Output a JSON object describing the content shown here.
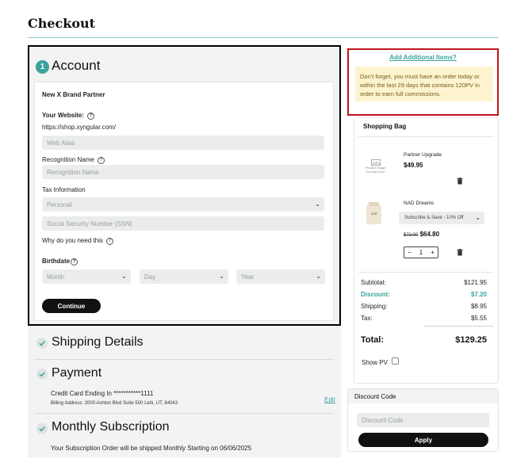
{
  "page": {
    "title": "Checkout"
  },
  "account": {
    "step_number": "1",
    "title": "Account",
    "brand_partner_label": "New X Brand Partner",
    "website_label": "Your Website:",
    "website_url": "https://shop.xyngular.com/",
    "web_alias_placeholder": "Web Alias",
    "recognition_label": "Recognition Name",
    "recognition_placeholder": "Recognition Name",
    "tax_label": "Tax Information",
    "tax_select_value": "Personal",
    "ssn_placeholder": "Social Security Number (SSN)",
    "why_label": "Why do you need this",
    "birthdate_label": "Birthdate",
    "month_value": "Month",
    "day_value": "Day",
    "year_value": "Year",
    "continue_label": "Continue"
  },
  "shipping": {
    "title": "Shipping Details"
  },
  "payment": {
    "title": "Payment",
    "card_text": "Credit Card Ending In ***********1111",
    "billing_text": "Billing Address: 2000 Ashton Blvd Suite 500 Lehi, UT, 84043",
    "edit_label": "Edit"
  },
  "subscription": {
    "title": "Monthly Subscription",
    "note": "Your Subscription Order will be shipped Monthly Starting on 06/06/2025"
  },
  "notice": {
    "add_items_label": "Add Additional Items?",
    "message": "Don't forget, you must have an order today or within the last 29 days that contains 120PV in order to earn full commissions."
  },
  "bag": {
    "title": "Shopping Bag",
    "items": [
      {
        "image_text": "Product Image Coming Soon",
        "name": "Partner Upgrade",
        "price": "$49.95"
      },
      {
        "name": "NAD Dreams",
        "option": "Subscribe & Save - 10% Off",
        "old_price": "$72.00",
        "price": "$64.80",
        "qty": "1",
        "minus": "−",
        "plus": "+"
      }
    ],
    "summary": [
      {
        "label": "Subtotal:",
        "value": "$121.95"
      },
      {
        "label": "Discount:",
        "value": "$7.20"
      },
      {
        "label": "Shipping:",
        "value": "$8.95"
      },
      {
        "label": "Tax:",
        "value": "$5.55"
      }
    ],
    "total_label": "Total:",
    "total_value": "$129.25",
    "show_pv_label": "Show PV"
  },
  "discount": {
    "title": "Discount Code",
    "placeholder": "Discount Code",
    "apply_label": "Apply"
  },
  "colors": {
    "accent": "#3aa39b",
    "highlight_red": "#c0141a",
    "notice_bg": "#fdf3cf"
  }
}
